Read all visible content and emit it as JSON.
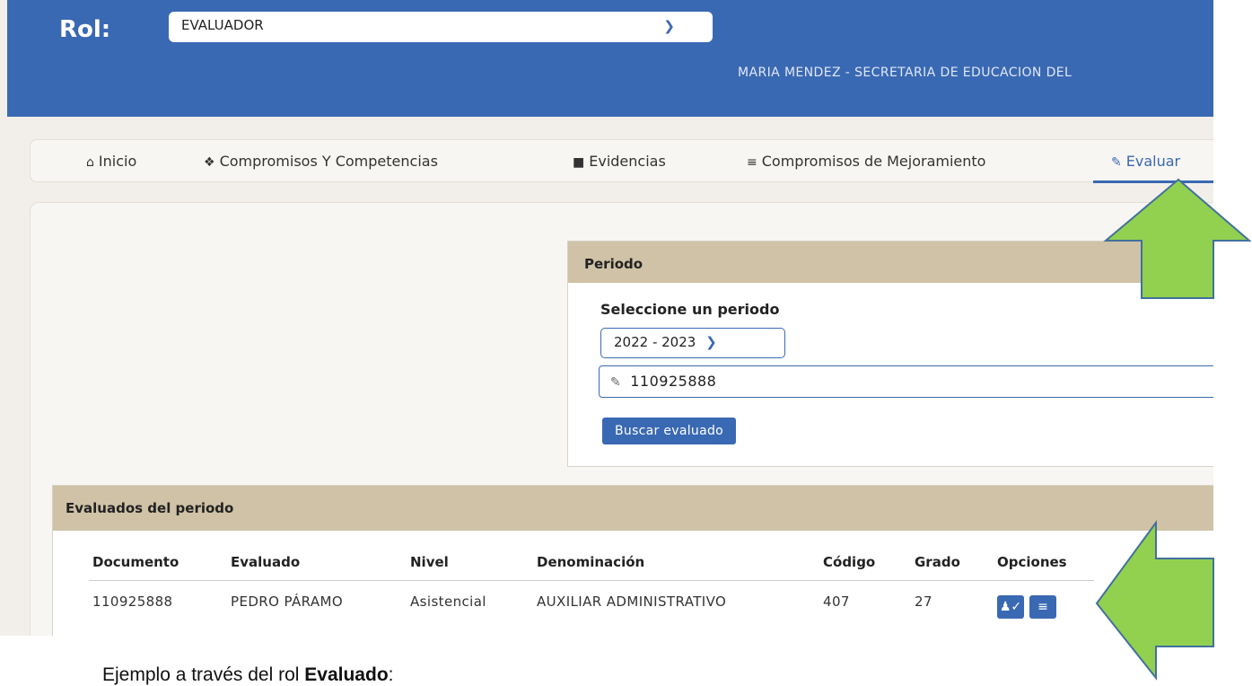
{
  "header": {
    "rol_label": "Rol:",
    "rol_value": "EVALUADOR",
    "user_info": "MARIA MENDEZ - SECRETARIA DE EDUCACION DEL"
  },
  "nav": {
    "items": [
      {
        "label": "Inicio",
        "icon": "home-icon"
      },
      {
        "label": "Compromisos Y Competencias",
        "icon": "handshake-icon"
      },
      {
        "label": "Evidencias",
        "icon": "save-icon"
      },
      {
        "label": "Compromisos de Mejoramiento",
        "icon": "list-icon"
      },
      {
        "label": "Evaluar",
        "icon": "edit-icon"
      }
    ],
    "active": "Evaluar"
  },
  "periodo": {
    "title": "Periodo",
    "select_label": "Seleccione un periodo",
    "selected_period": "2022 - 2023",
    "document_value": "110925888",
    "search_button": "Buscar evaluado"
  },
  "evaluados": {
    "title": "Evaluados del periodo",
    "columns": [
      "Documento",
      "Evaluado",
      "Nivel",
      "Denominación",
      "Código",
      "Grado",
      "Opciones"
    ],
    "rows": [
      {
        "documento": "110925888",
        "evaluado": "PEDRO PÁRAMO",
        "nivel": "Asistencial",
        "denominacion": "AUXILIAR ADMINISTRATIVO",
        "codigo": "407",
        "grado": "27",
        "options": [
          "user-check-icon",
          "list-icon"
        ]
      }
    ]
  },
  "caption": {
    "text": "Ejemplo a través del rol ",
    "bold": "Evaluado",
    "end": ":"
  },
  "colors": {
    "primary": "#3a69b3",
    "card_header": "#cfc2a6",
    "arrow_fill": "#92d050",
    "arrow_stroke": "#41719c"
  }
}
